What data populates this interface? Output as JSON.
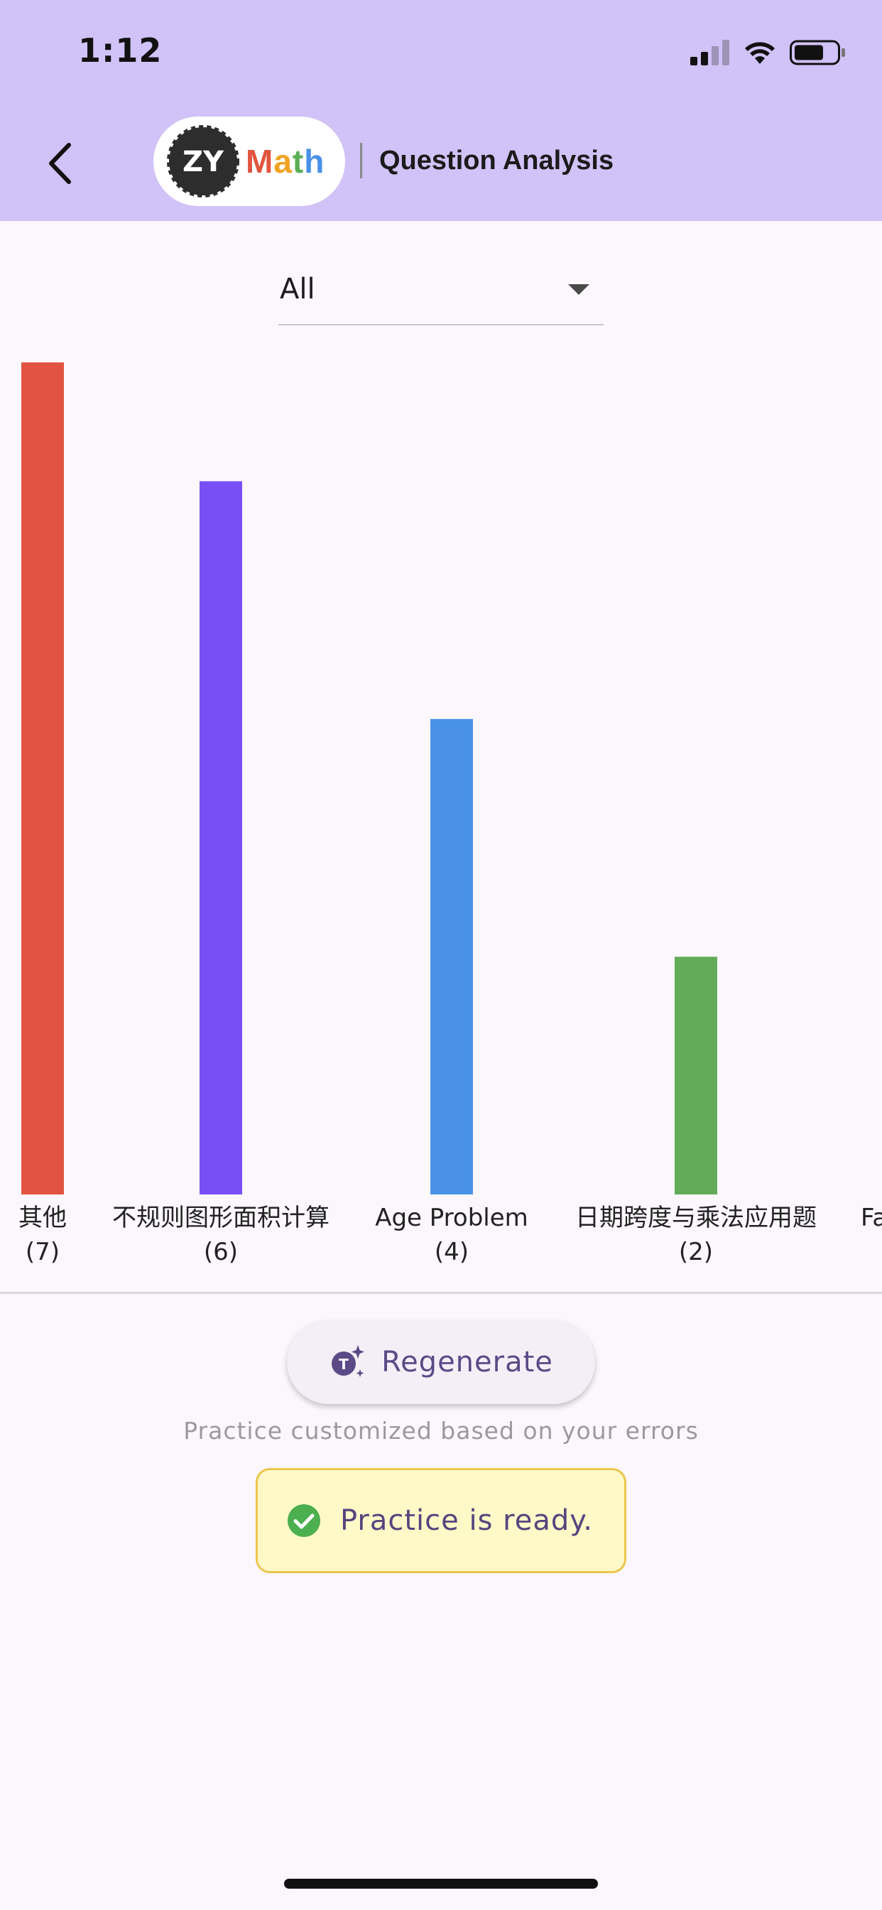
{
  "status_bar": {
    "time": "1:12"
  },
  "header": {
    "logo_badge": "ZY",
    "logo_letters": [
      {
        "text": "M",
        "color": "#e1553f"
      },
      {
        "text": "a",
        "color": "#f0a322"
      },
      {
        "text": "t",
        "color": "#5cae55"
      },
      {
        "text": "h",
        "color": "#4a90e6"
      }
    ],
    "title": "Question Analysis",
    "back_icon": "chevron-left-icon"
  },
  "filter": {
    "selected": "All"
  },
  "chart_data": {
    "type": "bar",
    "categories": [
      "其他",
      "不规则图形面积计算",
      "Age Problem",
      "日期跨度与乘法应用题",
      "Fa"
    ],
    "values": [
      7,
      6,
      4,
      2,
      null
    ],
    "value_labels": [
      "(7)",
      "(6)",
      "(4)",
      "(2)",
      ""
    ],
    "colors": [
      "#e25441",
      "#774ff5",
      "#4a92e8",
      "#63ab59",
      "#e25441"
    ],
    "ylim": [
      0,
      7
    ]
  },
  "regenerate": {
    "label": "Regenerate",
    "icon": "sparkle-t-icon"
  },
  "hint": "Practice customized based on your errors",
  "ready": {
    "label": "Practice is ready.",
    "icon": "check-circle-icon",
    "icon_color": "#4caf50"
  }
}
